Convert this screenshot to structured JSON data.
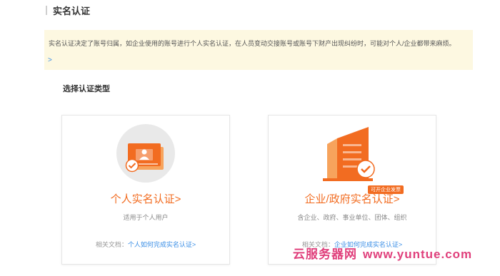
{
  "header": {
    "title": "实名认证"
  },
  "notice": {
    "text": "实名认证决定了账号归属，如企业使用的账号进行个人实名认证，在人员变动交接账号或账号下财产出现纠纷时，可能对个人/企业都带来麻烦。",
    "more": ">"
  },
  "section": {
    "title": "选择认证类型"
  },
  "cards": {
    "personal": {
      "title": "个人实名认证>",
      "desc": "适用于个人用户",
      "doc_prefix": "相关文档：",
      "doc_link": "个人如何完成实名认证>"
    },
    "enterprise": {
      "badge": "可开企业发票",
      "title": "企业/政府实名认证>",
      "desc": "含企业、政府、事业单位、团体、组织",
      "doc_prefix": "相关文档：",
      "doc_link": "企业如何完成实名认证>"
    }
  },
  "watermark": {
    "cn": "云服务器网",
    "url": "www.yuntue.com"
  },
  "colors": {
    "accent": "#f26c21",
    "link": "#3a8ee6",
    "notice_bg": "#fdf8e1",
    "watermark": "#e0407c"
  },
  "icons": {
    "personal": "id-card-icon",
    "enterprise": "building-icon",
    "check": "check-badge-icon"
  }
}
